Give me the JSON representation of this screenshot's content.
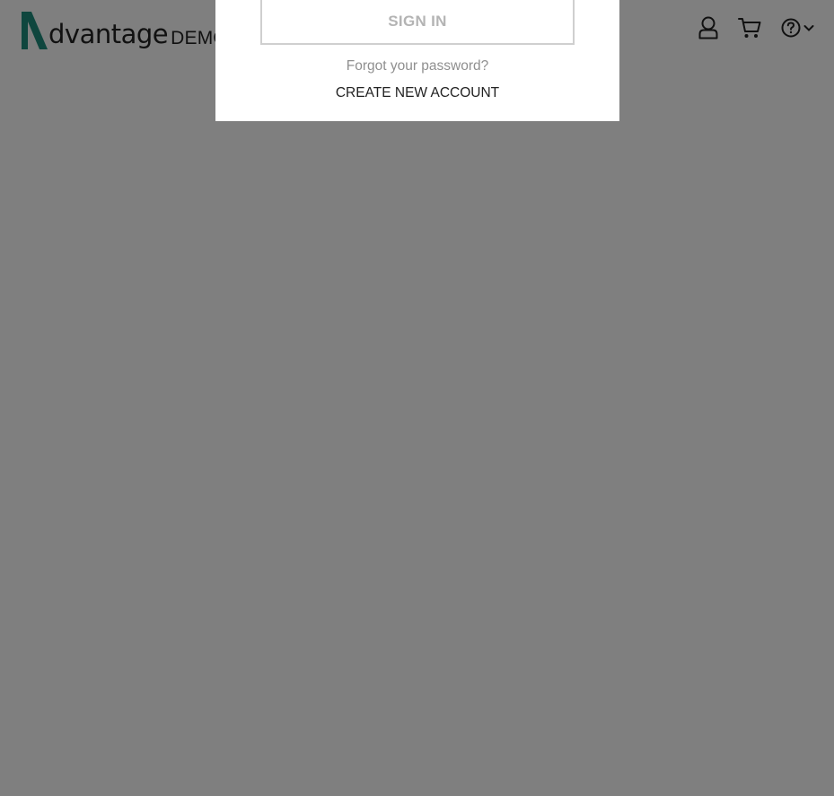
{
  "header": {
    "logo_text": "dvantage",
    "logo_suffix": "DEMO",
    "icons": [
      "user-icon",
      "cart-icon",
      "help-icon",
      "chevron-down-icon"
    ]
  },
  "login_dialog": {
    "sign_in_label": "SIGN IN",
    "forgot_password_label": "Forgot your password?",
    "create_account_label": "CREATE NEW ACCOUNT"
  },
  "colors": {
    "logo_accent": "#1f8c7c",
    "overlay": "#808080",
    "sign_in_text": "#b4b4b4",
    "link_muted": "#8f8f8f"
  }
}
